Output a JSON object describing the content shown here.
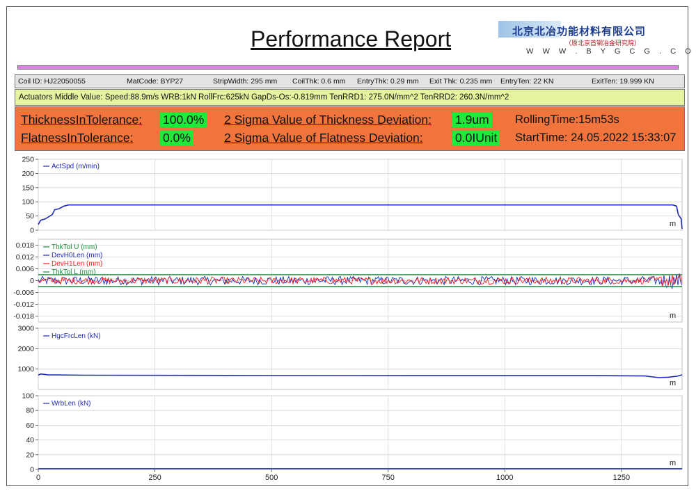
{
  "report": {
    "title": "Performance Report"
  },
  "logo": {
    "company_cn": "北京北冶功能材料有限公司",
    "sub_cn": "（原北京首钢冶金研究院）",
    "url": "W W W . B Y G C G . C O M"
  },
  "info": {
    "coil_id": "Coil ID: HJ22050055",
    "mat_code": "MatCode: BYP27",
    "strip_width": "StripWidth: 295 mm",
    "coil_thk": "CoilThk: 0.6 mm",
    "entry_thk": "EntryThk: 0.29 mm",
    "exit_thk": "Exit Thk: 0.235 mm",
    "entry_ten": "EntryTen: 22 KN",
    "exit_ten": "ExitTen: 19.999 KN"
  },
  "actuators": {
    "text": "Actuators Middle Value: Speed:88.9m/s WRB:1kN RollFrc:625kN GapDs-Os:-0.819mm TenRRD1: 275.0N/mm^2 TenRRD2: 260.3N/mm^2"
  },
  "tolerance": {
    "thickness_label": "ThicknessInTolerance:",
    "thickness_value": "100.0%",
    "flatness_label": "FlatnessInTolerance:",
    "flatness_value": "0.0%",
    "sigma_thk_label": "2 Sigma Value of Thickness Deviation:",
    "sigma_thk_value": "1.9um",
    "sigma_flat_label": "2 Sigma Value of Flatness Deviation:",
    "sigma_flat_value": "0.0IUnit",
    "rolling_time": "RollingTime:15m53s",
    "start_time": "StartTime: 24.05.2022 15:33:07"
  },
  "colors": {
    "blue": "#1f2ab8",
    "red": "#ff1a1a",
    "green": "#1a8a3a",
    "grid": "#d4d4d4"
  },
  "chart_data": [
    {
      "type": "line",
      "ylim": [
        0,
        250
      ],
      "yticks": [
        "250",
        "200",
        "150",
        "100",
        "50",
        "0"
      ],
      "xlim": [
        0,
        1380
      ],
      "unit_label": "m",
      "series": [
        {
          "name": "ActSpd (m/min)",
          "color": "#1f2ab8",
          "x": [
            0,
            5,
            15,
            30,
            35,
            45,
            55,
            65,
            1360,
            1368,
            1372,
            1378,
            1380
          ],
          "y": [
            20,
            35,
            40,
            55,
            72,
            76,
            85,
            88.9,
            88.9,
            85,
            55,
            40,
            5
          ]
        }
      ]
    },
    {
      "type": "line",
      "ylim": [
        -0.021,
        0.021
      ],
      "yticks": [
        "0.018",
        "0.012",
        "0.006",
        "0",
        "-0.006",
        "-0.012",
        "-0.018"
      ],
      "ytick_values": [
        0.018,
        0.012,
        0.006,
        0,
        -0.006,
        -0.012,
        -0.018
      ],
      "xlim": [
        0,
        1380
      ],
      "unit_label": "m",
      "series": [
        {
          "name": "ThkTol U (mm)",
          "color": "#1a8a3a",
          "x": [
            0,
            1380
          ],
          "y": [
            0.003,
            0.003
          ]
        },
        {
          "name": "DevH0Len (mm)",
          "color": "#1f2ab8",
          "noise": 0.0022,
          "x": [
            0,
            1380
          ],
          "y": [
            0,
            0
          ]
        },
        {
          "name": "DevH1Len (mm)",
          "color": "#ff1a1a",
          "noise": 0.0018,
          "x": [
            0,
            1380
          ],
          "y": [
            0,
            0
          ]
        },
        {
          "name": "ThkTol L (mm)",
          "color": "#1a8a3a",
          "x": [
            0,
            1380
          ],
          "y": [
            -0.003,
            -0.003
          ]
        }
      ]
    },
    {
      "type": "line",
      "ylim": [
        0,
        3000
      ],
      "yticks": [
        "3000",
        "2000",
        "1000"
      ],
      "ytick_values": [
        3000,
        2000,
        1000
      ],
      "xlim": [
        0,
        1380
      ],
      "unit_label": "m",
      "series": [
        {
          "name": "HgcFrcLen (kN)",
          "color": "#1f2ab8",
          "x": [
            0,
            5,
            20,
            100,
            400,
            800,
            1200,
            1300,
            1330,
            1350,
            1370,
            1380
          ],
          "y": [
            700,
            760,
            720,
            700,
            690,
            680,
            680,
            660,
            580,
            600,
            650,
            720
          ]
        }
      ]
    },
    {
      "type": "line",
      "ylim": [
        0,
        100
      ],
      "yticks": [
        "100",
        "80",
        "60",
        "40",
        "20",
        "0"
      ],
      "ytick_values": [
        100,
        80,
        60,
        40,
        20,
        0
      ],
      "xlim": [
        0,
        1380
      ],
      "xticks": [
        "0",
        "250",
        "500",
        "750",
        "1000",
        "1250"
      ],
      "xtick_values": [
        0,
        250,
        500,
        750,
        1000,
        1250
      ],
      "unit_label": "m",
      "series": [
        {
          "name": "WrbLen (kN)",
          "color": "#1f2ab8",
          "x": [
            0,
            1380
          ],
          "y": [
            1,
            1
          ]
        }
      ]
    }
  ]
}
